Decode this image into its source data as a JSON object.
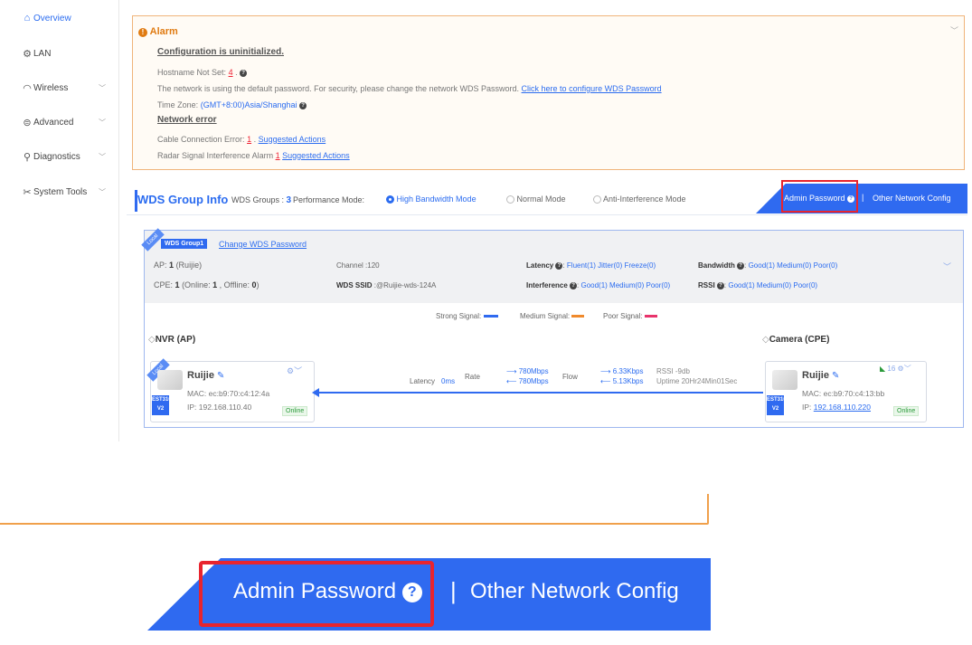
{
  "sidebar": {
    "items": [
      {
        "label": "Overview",
        "icon": "home-icon",
        "active": true
      },
      {
        "label": "LAN",
        "icon": "lan-icon",
        "active": false
      },
      {
        "label": "Wireless",
        "icon": "wireless-icon",
        "active": false
      },
      {
        "label": "Advanced",
        "icon": "advanced-icon",
        "active": false
      },
      {
        "label": "Diagnostics",
        "icon": "diagnostics-icon",
        "active": false
      },
      {
        "label": "System Tools",
        "icon": "tools-icon",
        "active": false
      }
    ]
  },
  "alarm": {
    "title": "Alarm",
    "config_heading": "Configuration is uninitialized.",
    "hostname_label": "Hostname Not Set:",
    "hostname_count": "4",
    "password_text": "The network is using the default password. For security, please change the network WDS Password.",
    "password_link": "Click here to configure WDS Password",
    "timezone_label": "Time Zone:",
    "timezone_value": "(GMT+8:00)Asia/Shanghai",
    "network_heading": "Network error",
    "cable_label": "Cable Connection Error:",
    "cable_count": "1",
    "cable_link": "Suggested Actions",
    "radar_label": "Radar Signal Interference Alarm",
    "radar_count": "1",
    "radar_link": "Suggested Actions"
  },
  "wds": {
    "title": "WDS Group Info",
    "groups_label": "WDS Groups :",
    "groups_value": "3",
    "perf_label": "Performance Mode:",
    "modes": [
      "High Bandwidth Mode",
      "Normal Mode",
      "Anti-Interference Mode"
    ],
    "admin_password": "Admin Password",
    "other_config": "Other Network Config"
  },
  "group": {
    "badge": "WDS Group1",
    "ribbon": "Local",
    "change_pw": "Change WDS Password",
    "ap_label": "AP:",
    "ap_count": "1",
    "ap_brand": "(Ruijie)",
    "cpe_label": "CPE:",
    "cpe_count": "1",
    "cpe_detail_a": "(Online:",
    "cpe_online": "1",
    "cpe_detail_b": ", Offline:",
    "cpe_offline": "0",
    "cpe_detail_c": ")",
    "channel": "Channel :120",
    "ssid_label": "WDS SSID",
    "ssid_value": ":@Ruijie-wds-124A",
    "latency_label": "Latency",
    "latency_values": "Fluent(1)  Jitter(0)  Freeze(0)",
    "interference_label": "Interference",
    "interference_values": "Good(1)  Medium(0)  Poor(0)",
    "bandwidth_label": "Bandwidth",
    "bandwidth_values": "Good(1)  Medium(0)  Poor(0)",
    "rssi_label": "RSSI",
    "rssi_values": "Good(1)  Medium(0)  Poor(0)",
    "legend": [
      {
        "label": "Strong Signal:",
        "color": "#2f6af0"
      },
      {
        "label": "Medium Signal:",
        "color": "#f08a2c"
      },
      {
        "label": "Poor Signal:",
        "color": "#e8336b"
      }
    ]
  },
  "nvr": {
    "title": "NVR (AP)",
    "name": "Ruijie",
    "mac": "MAC:  ec:b9:70:c4:12:4a",
    "ip": "IP:  192.168.110.40",
    "status": "Online",
    "model_a": "EST310-",
    "model_b": "V2"
  },
  "camera": {
    "title": "Camera (CPE)",
    "name": "Ruijie",
    "mac": "MAC:  ec:b9:70:c4:13:bb",
    "ip_label": "IP:",
    "ip": "192.168.110.220",
    "status": "Online",
    "signal": "16",
    "model_a": "EST310-",
    "model_b": "V2"
  },
  "link": {
    "latency_label": "Latency",
    "latency_value": "0ms",
    "rate_label": "Rate",
    "rate_tx": "780Mbps",
    "rate_rx": "780Mbps",
    "flow_label": "Flow",
    "flow_tx": "6.33Kbps",
    "flow_rx": "5.13Kbps",
    "rssi": "RSSI -9db",
    "uptime": "Uptime 20Hr24Min01Sec"
  },
  "colors": {
    "accent": "#2f6af0",
    "alarm": "#f0a04b",
    "alert_red": "#e22233",
    "online": "#2a9a3a"
  }
}
